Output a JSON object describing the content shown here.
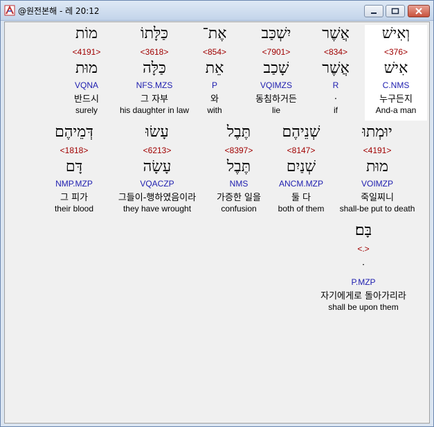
{
  "window": {
    "title": "@원전본해 - 레 20:12"
  },
  "controls": {
    "minimize": "minimize-icon",
    "maximize": "maximize-icon",
    "close": "close-icon"
  },
  "colors": {
    "strong": "#a00000",
    "parsing": "#2020b0",
    "highlight": "#ffffff"
  },
  "rows": [
    {
      "words": [
        {
          "heb": "וְאִישׁ",
          "strong": "<376>",
          "lemma": "אִישׁ",
          "parsing": "C.NMS",
          "kor": "누구든지",
          "eng": "And-a man"
        },
        {
          "heb": "אֲשֶׁר",
          "strong": "<834>",
          "lemma": "אֲשֶׁר",
          "parsing": "R",
          "kor": ".",
          "eng": "if"
        },
        {
          "heb": "יִשְׁכַּב",
          "strong": "<7901>",
          "lemma": "שָׁכַב",
          "parsing": "VQIMZS",
          "kor": "동침하거든",
          "eng": "lie"
        },
        {
          "heb": "אֶת־",
          "strong": "<854>",
          "lemma": "אֵת",
          "parsing": "P",
          "kor": "와",
          "eng": "with"
        },
        {
          "heb": "כַּלָּתוֹ",
          "strong": "<3618>",
          "lemma": "כַּלָּה",
          "parsing": "NFS.MZS",
          "kor": "그 자부",
          "eng": "his daughter in law"
        },
        {
          "heb": "מוֹת",
          "strong": "<4191>",
          "lemma": "מוּת",
          "parsing": "VQNA",
          "kor": "반드시",
          "eng": "surely"
        }
      ]
    },
    {
      "words": [
        {
          "heb": "יוּמְתוּ",
          "strong": "<4191>",
          "lemma": "מוּת",
          "parsing": "VOIMZP",
          "kor": "죽일찌니",
          "eng": "shall-be put to death"
        },
        {
          "heb": "שְׁנֵיהֶם",
          "strong": "<8147>",
          "lemma": "שְׁנַיִם",
          "parsing": "ANCM.MZP",
          "kor": "둘 다",
          "eng": "both of them"
        },
        {
          "heb": "תֶּבֶל",
          "strong": "<8397>",
          "lemma": "תֶּבֶל",
          "parsing": "NMS",
          "kor": "가증한 일을",
          "eng": "confusion"
        },
        {
          "heb": "עָשׂוּ",
          "strong": "<6213>",
          "lemma": "עָשָׂה",
          "parsing": "VQACZP",
          "kor": "그들이-행하였음이라",
          "eng": "they have wrought"
        },
        {
          "heb": "דְּמֵיהֶם",
          "strong": "<1818>",
          "lemma": "דָּם",
          "parsing": "NMP.MZP",
          "kor": "그 피가",
          "eng": "their blood"
        }
      ]
    },
    {
      "words": [
        {
          "heb": "בָּם׃",
          "strong": "<.>",
          "lemma": "ּ",
          "parsing": "P.MZP",
          "kor": "자기에게로 돌아가리라",
          "eng": "shall be upon them"
        }
      ]
    }
  ]
}
